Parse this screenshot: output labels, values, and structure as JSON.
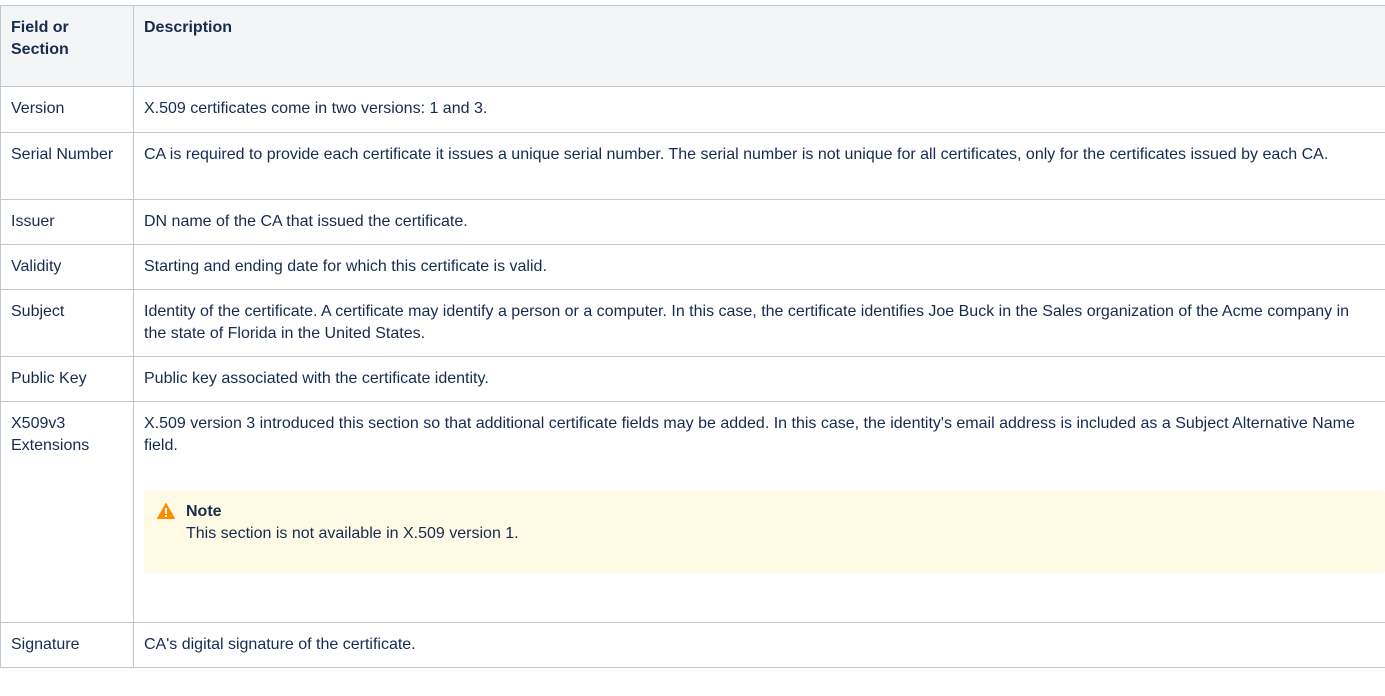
{
  "table": {
    "headers": {
      "field": "Field or Section",
      "description": "Description"
    },
    "rows": [
      {
        "field": "Version",
        "description": "X.509 certificates come in two versions: 1 and 3."
      },
      {
        "field": "Serial Number",
        "description": "CA is required to provide each certificate it issues a unique serial number. The serial number is not unique for all certificates, only for the certificates issued by each CA."
      },
      {
        "field": "Issuer",
        "description": "DN name of the CA that issued the certificate."
      },
      {
        "field": "Validity",
        "description": "Starting and ending date for which this certificate is valid."
      },
      {
        "field": "Subject",
        "description": "Identity of the certificate. A certificate may identify a person or a computer. In this case, the certificate identifies Joe Buck in the Sales organization of the Acme company in the state of Florida in the United States."
      },
      {
        "field": "Public Key",
        "description": "Public key associated with the certificate identity."
      },
      {
        "field": "X509v3 Extensions",
        "description": "X.509 version 3 introduced this section so that additional certificate fields may be added. In this case, the identity's email address is included as a Subject Alternative Name field."
      },
      {
        "field": "Signature",
        "description": "CA's digital signature of the certificate."
      }
    ]
  },
  "note": {
    "icon": "warning-icon",
    "title": "Note",
    "text": "This section is not available in X.509 version 1.",
    "icon_color": "#ff8b00",
    "background": "#fefae6"
  }
}
